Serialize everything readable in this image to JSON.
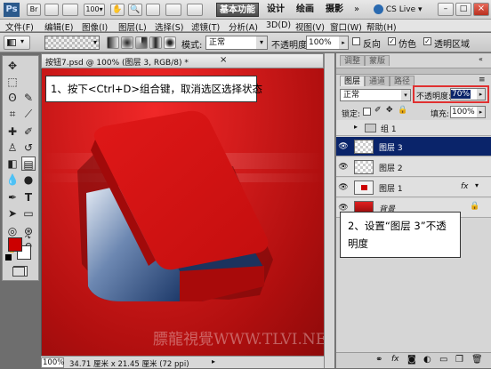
{
  "app": {
    "logo": "Ps",
    "workspaces": [
      "基本功能",
      "设计",
      "绘画",
      "摄影"
    ],
    "cs_live": "CS Live"
  },
  "menu": [
    "文件(F)",
    "编辑(E)",
    "图像(I)",
    "图层(L)",
    "选择(S)",
    "滤镜(T)",
    "分析(A)",
    "3D(D)",
    "视图(V)",
    "窗口(W)",
    "帮助(H)"
  ],
  "options": {
    "mode_label": "模式:",
    "mode_value": "正常",
    "opacity_label": "不透明度:",
    "opacity_value": "100%",
    "reverse_label": "反向",
    "dither_label": "仿色",
    "transparency_label": "透明区域"
  },
  "document": {
    "tab_title": "按钮7.psd @ 100% (图层 3, RGB/8) *",
    "zoom": "100%",
    "doc_info": "34.71 厘米 x 21.45 厘米 (72 ppi)",
    "watermark": "膘龍視覺WWW.TLVI.NET"
  },
  "callouts": {
    "step1": "1、按下<Ctrl+D>组合键，取消选区选择状态",
    "step2": "2、设置“图层 3”不透明度"
  },
  "panel": {
    "top_tabs": [
      "调整",
      "蒙版"
    ],
    "tabs": [
      "图层",
      "通道",
      "路径"
    ],
    "blend_mode": "正常",
    "opacity_label": "不透明度:",
    "opacity_value": "70%",
    "lock_label": "锁定:",
    "fill_label": "填充:",
    "fill_value": "100%",
    "layers": [
      {
        "name": "组 1",
        "type": "group"
      },
      {
        "name": "图层 3",
        "type": "layer",
        "selected": true
      },
      {
        "name": "图层 2",
        "type": "layer"
      },
      {
        "name": "图层 1",
        "type": "layer",
        "fx": "fx"
      },
      {
        "name": "背景",
        "type": "background"
      }
    ]
  },
  "colors": {
    "selected_layer": "#0a246a",
    "highlight_box": "#e03030",
    "foreground": "#cc0000",
    "background_swatch": "#ffffff"
  }
}
